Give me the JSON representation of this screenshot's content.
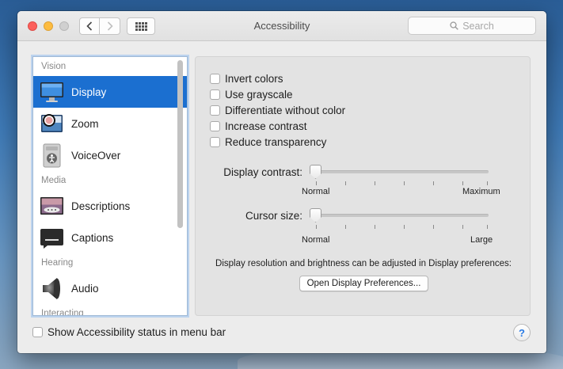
{
  "window": {
    "title": "Accessibility"
  },
  "toolbar": {
    "back_icon": "chevron-left",
    "forward_icon": "chevron-right",
    "grid_icon": "show-all-grid"
  },
  "search": {
    "placeholder": "Search"
  },
  "sidebar": {
    "sections": [
      {
        "label": "Vision",
        "items": [
          {
            "label": "Display",
            "icon": "display-monitor",
            "selected": true
          },
          {
            "label": "Zoom",
            "icon": "magnifier-zoom",
            "selected": false
          },
          {
            "label": "VoiceOver",
            "icon": "voiceover-speaker",
            "selected": false
          }
        ]
      },
      {
        "label": "Media",
        "items": [
          {
            "label": "Descriptions",
            "icon": "descriptions-speech",
            "selected": false
          },
          {
            "label": "Captions",
            "icon": "captions-bubble",
            "selected": false
          }
        ]
      },
      {
        "label": "Hearing",
        "items": [
          {
            "label": "Audio",
            "icon": "audio-speaker",
            "selected": false
          }
        ]
      },
      {
        "label": "Interacting",
        "items": []
      }
    ]
  },
  "display": {
    "checkboxes": [
      {
        "label": "Invert colors",
        "checked": false
      },
      {
        "label": "Use grayscale",
        "checked": false
      },
      {
        "label": "Differentiate without color",
        "checked": false
      },
      {
        "label": "Increase contrast",
        "checked": false
      },
      {
        "label": "Reduce transparency",
        "checked": false
      }
    ],
    "contrast": {
      "label": "Display contrast:",
      "min_label": "Normal",
      "max_label": "Maximum",
      "value": 0
    },
    "cursor": {
      "label": "Cursor size:",
      "min_label": "Normal",
      "max_label": "Large",
      "value": 0
    },
    "note": "Display resolution and brightness can be adjusted in Display preferences:",
    "open_button": "Open Display Preferences..."
  },
  "footer": {
    "status_checkbox_label": "Show Accessibility status in menu bar",
    "status_checked": false,
    "help": "?"
  }
}
